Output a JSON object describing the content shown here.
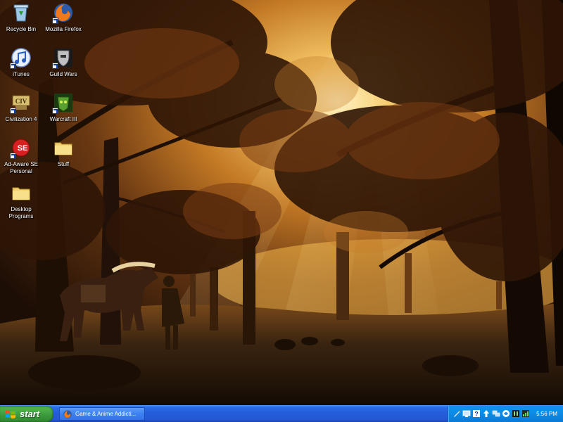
{
  "desktop": {
    "icons": [
      {
        "label": "Recycle Bin",
        "icon": "recycle-bin-icon"
      },
      {
        "label": "Mozilla Firefox",
        "icon": "firefox-icon"
      },
      {
        "label": "iTunes",
        "icon": "itunes-icon"
      },
      {
        "label": "Guild Wars",
        "icon": "guild-wars-icon"
      },
      {
        "label": "Civilization 4",
        "icon": "civilization-icon"
      },
      {
        "label": "Warcraft III",
        "icon": "warcraft-icon"
      },
      {
        "label": "Ad-Aware SE Personal",
        "icon": "ad-aware-icon"
      },
      {
        "label": "Stuff",
        "icon": "folder-icon"
      },
      {
        "label": "Desktop Programs",
        "icon": "folder-icon"
      }
    ]
  },
  "taskbar": {
    "start_label": "start",
    "task_item": {
      "label": "Game & Anime Addicti...",
      "icon": "firefox-icon"
    },
    "tray_icons": [
      "pen-icon",
      "monitor-icon",
      "help-icon",
      "update-icon",
      "network-icon",
      "lock-icon",
      "speaker-icon",
      "meter-icon"
    ],
    "clock": "5:56 PM"
  },
  "colors": {
    "taskbar_blue": "#245edb",
    "start_green": "#3a9a3a",
    "tray_blue": "#0d8de8"
  }
}
